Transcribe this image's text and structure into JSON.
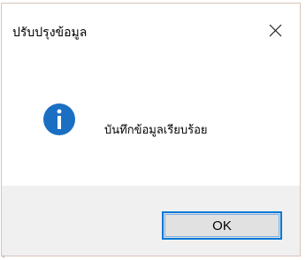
{
  "dialog": {
    "title": "ปรับปรุงข้อมูล",
    "message": "บันทึกข้อมูลเรียบร้อย",
    "ok_label": "OK",
    "icon": "info-icon",
    "close_icon": "close-icon"
  },
  "colors": {
    "accent": "#0078d7",
    "icon_blue": "#1a6fc2",
    "footer_bg": "#f0f0f0",
    "button_bg": "#e1e1e1"
  }
}
